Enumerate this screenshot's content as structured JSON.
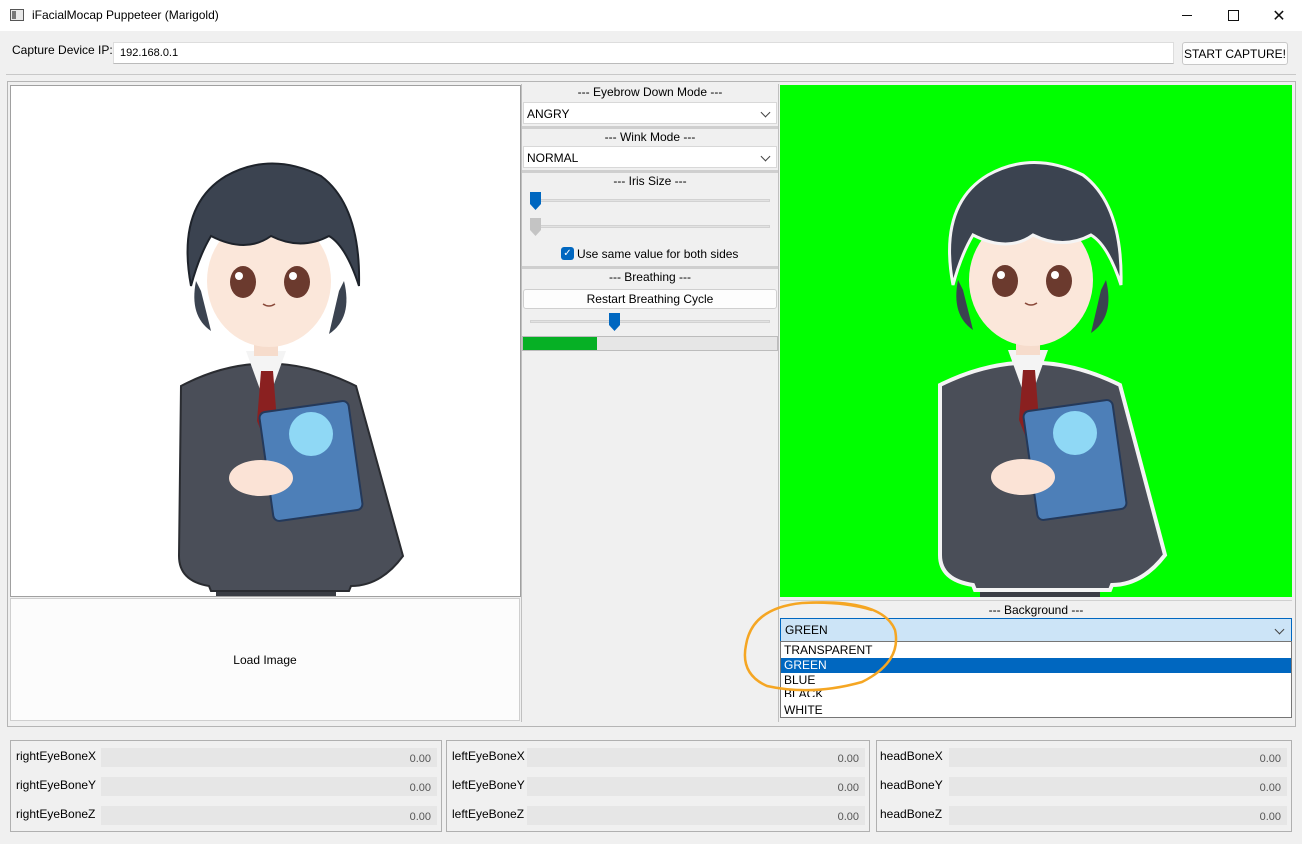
{
  "window": {
    "title": "iFacialMocap Puppeteer (Marigold)"
  },
  "capture": {
    "ip_label": "Capture Device IP:",
    "ip_value": "192.168.0.1",
    "start_label": "START CAPTURE!"
  },
  "left": {
    "load_image_label": "Load Image"
  },
  "eyebrow": {
    "title": "--- Eyebrow Down Mode ---",
    "selected": "ANGRY"
  },
  "wink": {
    "title": "--- Wink Mode ---",
    "selected": "NORMAL"
  },
  "iris": {
    "title": "--- Iris Size ---",
    "left_value_fraction": 0.0,
    "right_value_fraction": 0.0,
    "same_value_label": "Use same value for both sides",
    "same_value_checked": true
  },
  "breathing": {
    "title": "--- Breathing ---",
    "restart_label": "Restart Breathing Cycle",
    "slider_fraction": 0.33,
    "progress_fraction": 0.29
  },
  "background": {
    "title": "--- Background ---",
    "selected": "GREEN",
    "preview_color": "#00ff00",
    "options": [
      "TRANSPARENT",
      "GREEN",
      "BLUE",
      "BLACK",
      "WHITE"
    ],
    "highlighted_option": "GREEN"
  },
  "bones": {
    "right": [
      {
        "label": "rightEyeBoneX",
        "value": "0.00"
      },
      {
        "label": "rightEyeBoneY",
        "value": "0.00"
      },
      {
        "label": "rightEyeBoneZ",
        "value": "0.00"
      }
    ],
    "left": [
      {
        "label": "leftEyeBoneX",
        "value": "0.00"
      },
      {
        "label": "leftEyeBoneY",
        "value": "0.00"
      },
      {
        "label": "leftEyeBoneZ",
        "value": "0.00"
      }
    ],
    "head": [
      {
        "label": "headBoneX",
        "value": "0.00"
      },
      {
        "label": "headBoneY",
        "value": "0.00"
      },
      {
        "label": "headBoneZ",
        "value": "0.00"
      }
    ]
  },
  "colors": {
    "accent": "#0067c0",
    "progress": "#06b025",
    "annotation": "#f5a623"
  }
}
